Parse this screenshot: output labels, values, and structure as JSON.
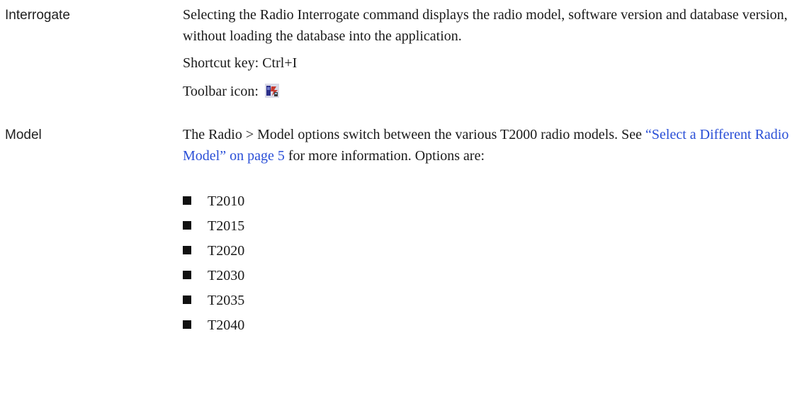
{
  "interrogate": {
    "term": "Interrogate",
    "description": "Selecting the Radio Interrogate command displays the radio model, software version and database version, without loading the database into the application.",
    "shortcut": "Shortcut key: Ctrl+I",
    "toolbar_label": "Toolbar icon:",
    "toolbar_icon": "radio-interrogate-icon"
  },
  "model": {
    "term": "Model",
    "text_before": "The Radio > Model options switch between the various T2000 radio models. See ",
    "link_text": "“Select a Different Radio Model” on page 5",
    "text_after": " for more information. Options are:",
    "options": [
      "T2010",
      "T2015",
      "T2020",
      "T2030",
      "T2035",
      "T2040"
    ]
  },
  "colors": {
    "link": "#2a4fd7",
    "text": "#1a1a1a"
  }
}
